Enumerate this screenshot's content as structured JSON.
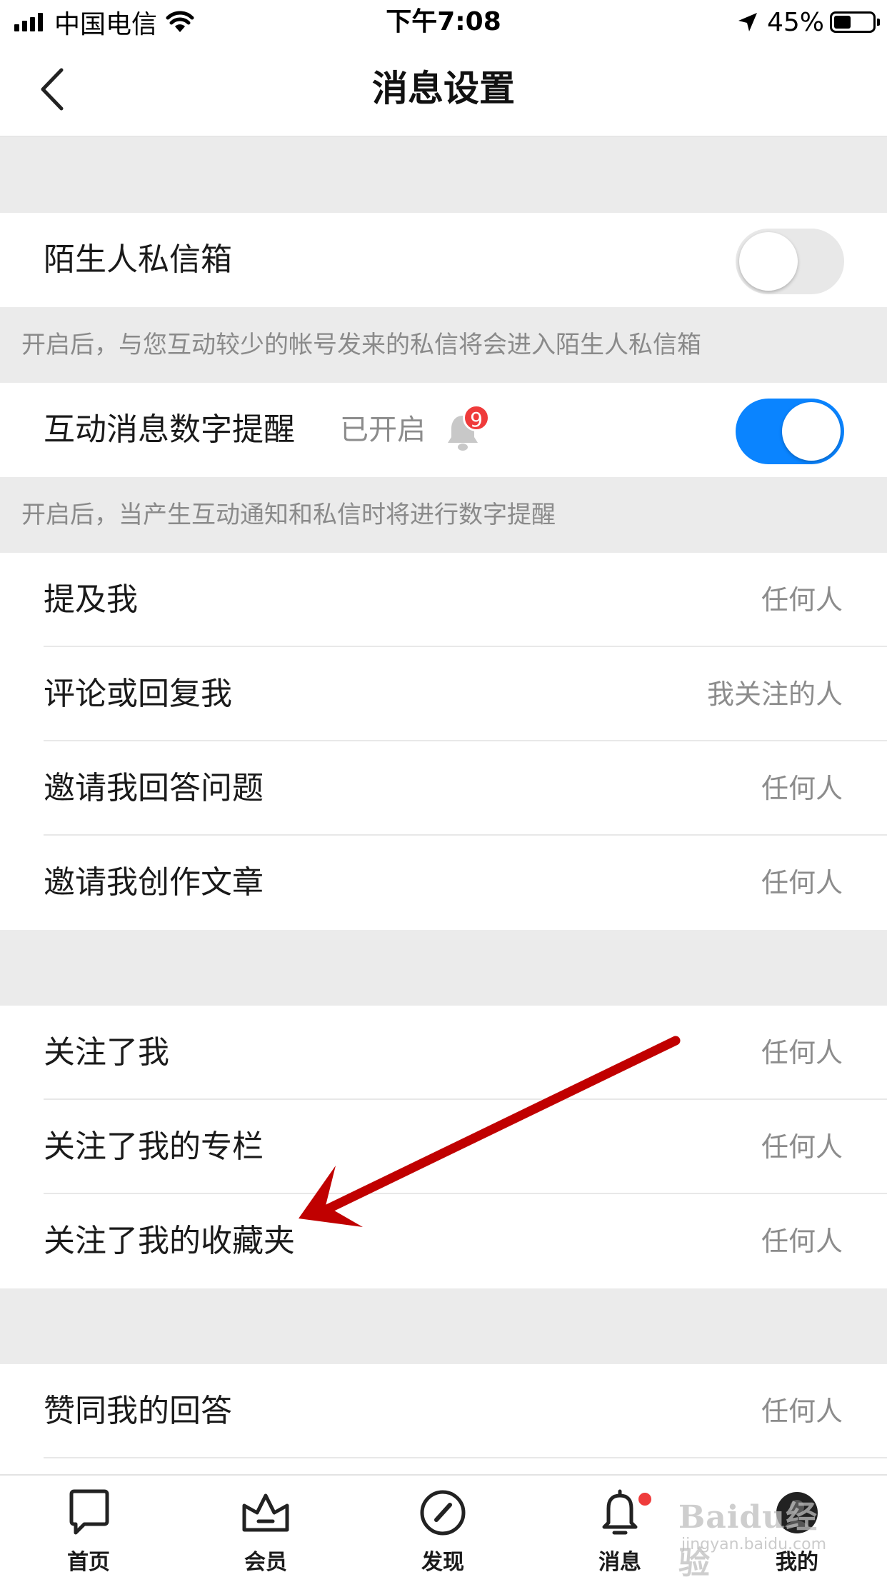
{
  "status_bar": {
    "carrier": "中国电信",
    "time": "下午7:08",
    "battery_percent": "45%",
    "battery_level": 0.45,
    "icons": [
      "signal-icon",
      "wifi-icon",
      "location-arrow-icon",
      "battery-icon"
    ]
  },
  "nav": {
    "title": "消息设置",
    "back_icon": "chevron-left-icon"
  },
  "settings": {
    "stranger_inbox": {
      "label": "陌生人私信箱",
      "enabled": false
    },
    "stranger_inbox_hint": "开启后，与您互动较少的帐号发来的私信将会进入陌生人私信箱",
    "badge_reminder": {
      "label": "互动消息数字提醒",
      "status": "已开启",
      "badge_count": "9",
      "enabled": true
    },
    "badge_reminder_hint": "开启后，当产生互动通知和私信时将进行数字提醒",
    "group1": [
      {
        "label": "提及我",
        "value": "任何人"
      },
      {
        "label": "评论或回复我",
        "value": "我关注的人"
      },
      {
        "label": "邀请我回答问题",
        "value": "任何人"
      },
      {
        "label": "邀请我创作文章",
        "value": "任何人"
      }
    ],
    "group2": [
      {
        "label": "关注了我",
        "value": "任何人"
      },
      {
        "label": "关注了我的专栏",
        "value": "任何人"
      },
      {
        "label": "关注了我的收藏夹",
        "value": "任何人"
      }
    ],
    "group3": [
      {
        "label": "赞同我的回答",
        "value": "任何人"
      }
    ]
  },
  "tab_bar": {
    "tabs": [
      {
        "label": "首页",
        "icon": "home-flag-icon"
      },
      {
        "label": "会员",
        "icon": "crown-icon"
      },
      {
        "label": "发现",
        "icon": "compass-icon"
      },
      {
        "label": "消息",
        "icon": "bell-icon",
        "has_dot": true
      },
      {
        "label": "我的",
        "icon": "avatar-icon"
      }
    ]
  },
  "watermark": {
    "text": "Baidu经验",
    "sub": "jingyan.baidu.com"
  },
  "colors": {
    "accent": "#0a84ff",
    "badge": "#ef3b3b",
    "annotation_arrow": "#c00000",
    "section_bg": "#ebebeb"
  }
}
